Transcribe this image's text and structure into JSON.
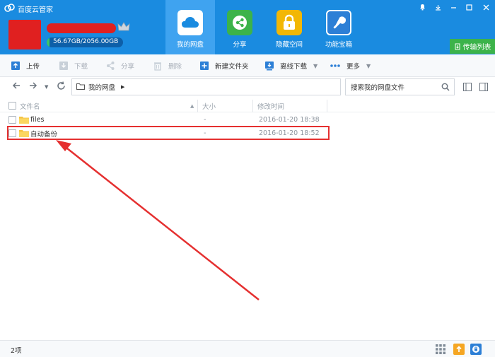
{
  "app": {
    "title": "百度云管家"
  },
  "account": {
    "quota_text": "56.67GB/2056.00GB",
    "quota_used_fraction": 0.0276
  },
  "nav": {
    "tabs": [
      {
        "label": "我的网盘",
        "active": true
      },
      {
        "label": "分享",
        "active": false
      },
      {
        "label": "隐藏空间",
        "active": false
      },
      {
        "label": "功能宝箱",
        "active": false
      }
    ],
    "transfer_label": "传输列表"
  },
  "toolbar": {
    "upload": "上传",
    "download": "下载",
    "share": "分享",
    "delete": "删除",
    "new_folder": "新建文件夹",
    "offline_download": "离线下载",
    "more": "更多"
  },
  "address": {
    "breadcrumb": "我的网盘",
    "search_placeholder": "搜索我的网盘文件"
  },
  "columns": {
    "name": "文件名",
    "size": "大小",
    "modified": "修改时间"
  },
  "files": [
    {
      "name": "files",
      "size": "-",
      "modified": "2016-01-20 18:38"
    },
    {
      "name": "自动备份",
      "size": "-",
      "modified": "2016-01-20 18:52"
    }
  ],
  "status": {
    "count": "2项"
  },
  "colors": {
    "header": "#1a8be0",
    "active_tab": "#3fa3f0",
    "transfer": "#3cb34a",
    "annotation": "#e53030"
  }
}
